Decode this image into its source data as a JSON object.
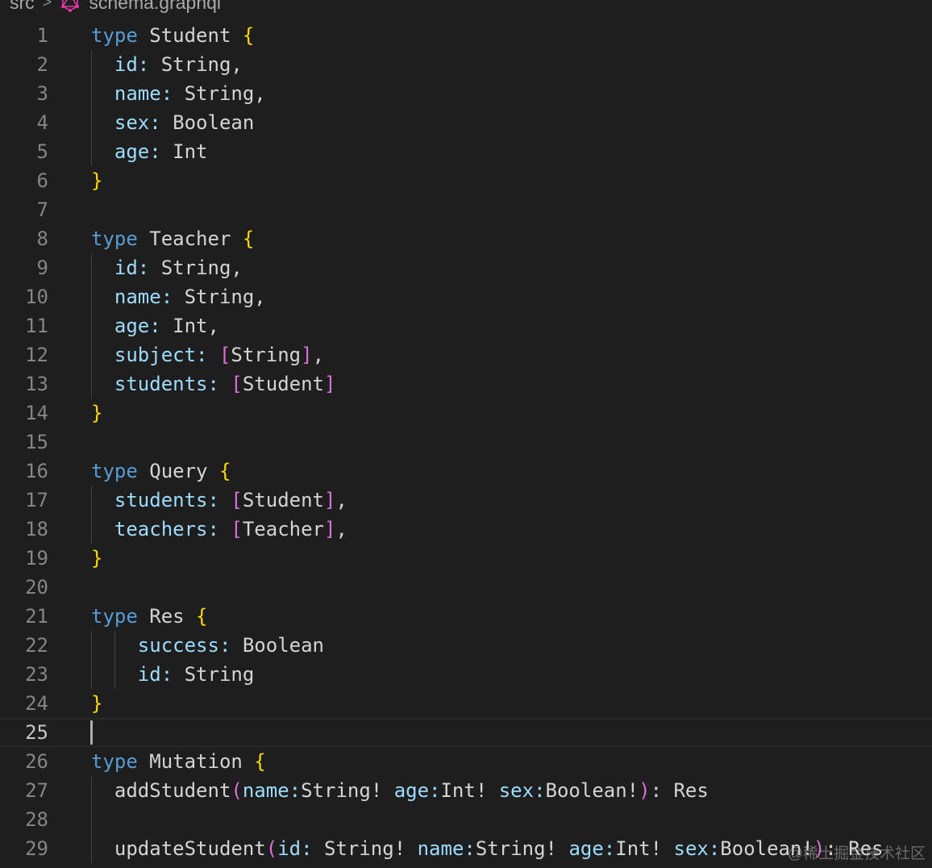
{
  "breadcrumb": {
    "folder": "src",
    "file": "schema.graphql"
  },
  "current_line": 25,
  "watermark": "@稀土掘金技术社区",
  "colors": {
    "keyword": "#569cd6",
    "brace": "#ffd700",
    "field": "#9cdcfe",
    "bracket": "#da70d6",
    "text": "#d4d4d4"
  },
  "lines": [
    [
      [
        "kw",
        "type"
      ],
      [
        "tx",
        " Student "
      ],
      [
        "br",
        "{"
      ]
    ],
    [
      [
        "tx",
        "  "
      ],
      [
        "fd",
        "id:"
      ],
      [
        "tx",
        " String,"
      ]
    ],
    [
      [
        "tx",
        "  "
      ],
      [
        "fd",
        "name:"
      ],
      [
        "tx",
        " String,"
      ]
    ],
    [
      [
        "tx",
        "  "
      ],
      [
        "fd",
        "sex:"
      ],
      [
        "tx",
        " Boolean"
      ]
    ],
    [
      [
        "tx",
        "  "
      ],
      [
        "fd",
        "age:"
      ],
      [
        "tx",
        " Int"
      ]
    ],
    [
      [
        "br",
        "}"
      ]
    ],
    [],
    [
      [
        "kw",
        "type"
      ],
      [
        "tx",
        " Teacher "
      ],
      [
        "br",
        "{"
      ]
    ],
    [
      [
        "tx",
        "  "
      ],
      [
        "fd",
        "id:"
      ],
      [
        "tx",
        " String,"
      ]
    ],
    [
      [
        "tx",
        "  "
      ],
      [
        "fd",
        "name:"
      ],
      [
        "tx",
        " String,"
      ]
    ],
    [
      [
        "tx",
        "  "
      ],
      [
        "fd",
        "age:"
      ],
      [
        "tx",
        " Int,"
      ]
    ],
    [
      [
        "tx",
        "  "
      ],
      [
        "fd",
        "subject:"
      ],
      [
        "tx",
        " "
      ],
      [
        "sq",
        "["
      ],
      [
        "tx",
        "String"
      ],
      [
        "sq",
        "]"
      ],
      [
        "tx",
        ","
      ]
    ],
    [
      [
        "tx",
        "  "
      ],
      [
        "fd",
        "students:"
      ],
      [
        "tx",
        " "
      ],
      [
        "sq",
        "["
      ],
      [
        "tx",
        "Student"
      ],
      [
        "sq",
        "]"
      ]
    ],
    [
      [
        "br",
        "}"
      ]
    ],
    [],
    [
      [
        "kw",
        "type"
      ],
      [
        "tx",
        " Query "
      ],
      [
        "br",
        "{"
      ]
    ],
    [
      [
        "tx",
        "  "
      ],
      [
        "fd",
        "students:"
      ],
      [
        "tx",
        " "
      ],
      [
        "sq",
        "["
      ],
      [
        "tx",
        "Student"
      ],
      [
        "sq",
        "]"
      ],
      [
        "tx",
        ","
      ]
    ],
    [
      [
        "tx",
        "  "
      ],
      [
        "fd",
        "teachers:"
      ],
      [
        "tx",
        " "
      ],
      [
        "sq",
        "["
      ],
      [
        "tx",
        "Teacher"
      ],
      [
        "sq",
        "]"
      ],
      [
        "tx",
        ","
      ]
    ],
    [
      [
        "br",
        "}"
      ]
    ],
    [],
    [
      [
        "kw",
        "type"
      ],
      [
        "tx",
        " Res "
      ],
      [
        "br",
        "{"
      ]
    ],
    [
      [
        "tx",
        "    "
      ],
      [
        "fd",
        "success:"
      ],
      [
        "tx",
        " Boolean"
      ]
    ],
    [
      [
        "tx",
        "    "
      ],
      [
        "fd",
        "id:"
      ],
      [
        "tx",
        " String"
      ]
    ],
    [
      [
        "br",
        "}"
      ]
    ],
    [],
    [
      [
        "kw",
        "type"
      ],
      [
        "tx",
        " Mutation "
      ],
      [
        "br",
        "{"
      ]
    ],
    [
      [
        "tx",
        "  addStudent"
      ],
      [
        "sq",
        "("
      ],
      [
        "fd",
        "name:"
      ],
      [
        "tx",
        "String! "
      ],
      [
        "fd",
        "age:"
      ],
      [
        "tx",
        "Int! "
      ],
      [
        "fd",
        "sex:"
      ],
      [
        "tx",
        "Boolean!"
      ],
      [
        "sq",
        ")"
      ],
      [
        "tx",
        ": Res"
      ]
    ],
    [],
    [
      [
        "tx",
        "  updateStudent"
      ],
      [
        "sq",
        "("
      ],
      [
        "fd",
        "id:"
      ],
      [
        "tx",
        " String! "
      ],
      [
        "fd",
        "name:"
      ],
      [
        "tx",
        "String! "
      ],
      [
        "fd",
        "age:"
      ],
      [
        "tx",
        "Int! "
      ],
      [
        "fd",
        "sex:"
      ],
      [
        "tx",
        "Boolean!"
      ],
      [
        "sq",
        ")"
      ],
      [
        "tx",
        ": Res"
      ]
    ]
  ]
}
